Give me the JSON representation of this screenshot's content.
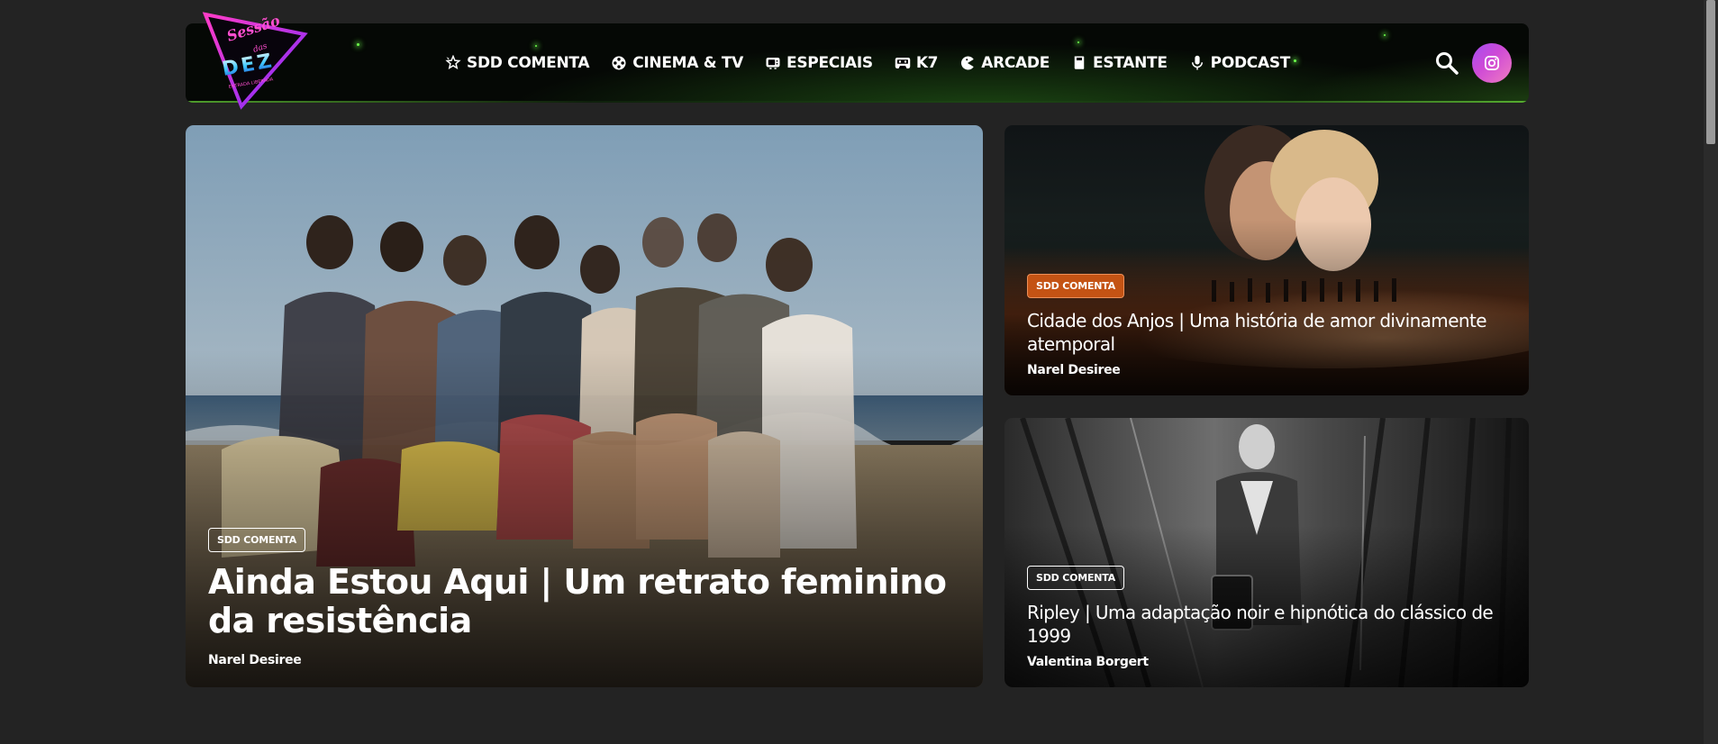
{
  "site": {
    "logo_text": [
      "Sessão",
      "das",
      "DEZ",
      "Entrada Liberada"
    ]
  },
  "nav": [
    {
      "label": "SDD COMENTA",
      "icon": "star-pen-icon"
    },
    {
      "label": "CINEMA & TV",
      "icon": "film-reel-icon"
    },
    {
      "label": "ESPECIAIS",
      "icon": "tv-icon"
    },
    {
      "label": "K7",
      "icon": "cassette-icon"
    },
    {
      "label": "ARCADE",
      "icon": "pacman-icon"
    },
    {
      "label": "ESTANTE",
      "icon": "book-icon"
    },
    {
      "label": "PODCAST",
      "icon": "microphone-icon"
    }
  ],
  "header_actions": {
    "search_icon": "search-icon",
    "instagram_icon": "instagram-icon"
  },
  "featured": {
    "badge": "SDD COMENTA",
    "title": "Ainda Estou Aqui | Um retrato feminino da resistência",
    "author": "Narel Desiree"
  },
  "side_posts": [
    {
      "badge": "SDD COMENTA",
      "title": "Cidade dos Anjos | Uma história de amor divinamente atemporal",
      "author": "Narel Desiree"
    },
    {
      "badge": "SDD COMENTA",
      "title": "Ripley | Uma adaptação noir e hipnótica do clássico de 1999",
      "author": "Valentina Borgert"
    }
  ],
  "colors": {
    "page_bg": "#232323",
    "header_bg": "#050805",
    "accent_green": "#6dff4c",
    "badge_orange": "#c45314",
    "instagram_gradient_start": "#a34cf2",
    "instagram_gradient_end": "#f07cc1"
  }
}
